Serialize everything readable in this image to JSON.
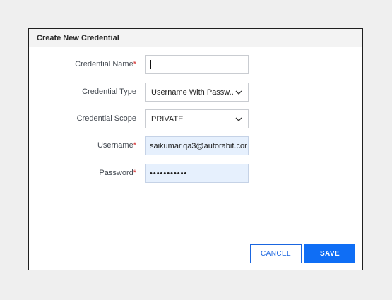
{
  "dialog": {
    "title": "Create New Credential"
  },
  "form": {
    "credential_name": {
      "label": "Credential Name",
      "required_mark": "*",
      "value": ""
    },
    "credential_type": {
      "label": "Credential Type",
      "value": "Username With Passw..."
    },
    "credential_scope": {
      "label": "Credential Scope",
      "value": "PRIVATE"
    },
    "username": {
      "label": "Username",
      "required_mark": "*",
      "value": "saikumar.qa3@autorabit.cor"
    },
    "password": {
      "label": "Password",
      "required_mark": "*",
      "value": "•••••••••••"
    }
  },
  "footer": {
    "cancel_label": "CANCEL",
    "save_label": "SAVE"
  },
  "icons": {
    "dropdown": "chevron-down-icon"
  },
  "colors": {
    "primary": "#0f6ef5",
    "required": "#d32f2f",
    "autofill_bg": "#e6f0fd"
  }
}
